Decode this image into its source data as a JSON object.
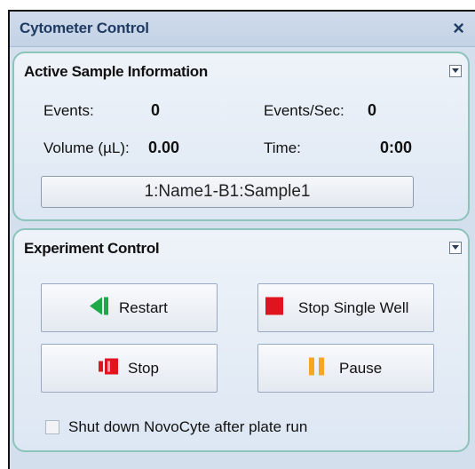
{
  "window": {
    "title": "Cytometer Control"
  },
  "active_sample": {
    "title": "Active Sample Information",
    "events_label": "Events:",
    "events_value": "0",
    "events_per_sec_label": "Events/Sec:",
    "events_per_sec_value": "0",
    "volume_label": "Volume (µL):",
    "volume_value": "0.00",
    "time_label": "Time:",
    "time_value": "0:00",
    "sample_button": "1:Name1-B1:Sample1"
  },
  "experiment_control": {
    "title": "Experiment Control",
    "restart_label": "Restart",
    "stop_single_well_label": "Stop Single Well",
    "stop_label": "Stop",
    "pause_label": "Pause",
    "shutdown_checkbox_label": "Shut down NovoCyte after plate run",
    "shutdown_checked": false
  },
  "colors": {
    "restart_icon": "#1ea84a",
    "stop_icon": "#e0141e",
    "pause_icon": "#f5a623"
  }
}
